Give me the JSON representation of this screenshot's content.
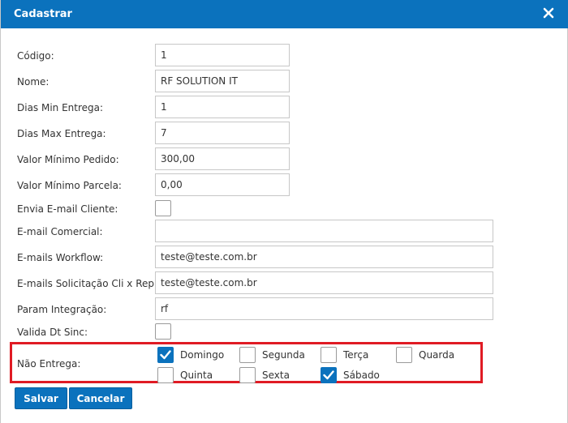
{
  "dialog": {
    "title": "Cadastrar",
    "close_icon": "close-icon"
  },
  "fields": {
    "codigo": {
      "label": "Código:",
      "value": "1"
    },
    "nome": {
      "label": "Nome:",
      "value": "RF SOLUTION IT"
    },
    "dias_min": {
      "label": "Dias Min Entrega:",
      "value": "1"
    },
    "dias_max": {
      "label": "Dias Max Entrega:",
      "value": "7"
    },
    "valor_min_pedido": {
      "label": "Valor Mínimo Pedido:",
      "value": "300,00"
    },
    "valor_min_parcela": {
      "label": "Valor Mínimo Parcela:",
      "value": "0,00"
    },
    "envia_email": {
      "label": "Envia E-mail Cliente:",
      "checked": false
    },
    "email_comercial": {
      "label": "E-mail Comercial:",
      "value": ""
    },
    "emails_workflow": {
      "label": "E-mails Workflow:",
      "value": "teste@teste.com.br"
    },
    "emails_solicitacao": {
      "label": "E-mails Solicitação Cli x Rep:",
      "value": "teste@teste.com.br"
    },
    "param_integracao": {
      "label": "Param Integração:",
      "value": "rf"
    },
    "valida_dt_sinc": {
      "label": "Valida Dt Sinc:",
      "checked": false
    }
  },
  "nao_entrega": {
    "label": "Não Entrega:",
    "highlight_color": "#e01b24",
    "days": [
      {
        "name": "Domingo",
        "checked": true
      },
      {
        "name": "Segunda",
        "checked": false
      },
      {
        "name": "Terça",
        "checked": false
      },
      {
        "name": "Quarda",
        "checked": false
      },
      {
        "name": "Quinta",
        "checked": false
      },
      {
        "name": "Sexta",
        "checked": false
      },
      {
        "name": "Sábado",
        "checked": true
      }
    ]
  },
  "buttons": {
    "save_label": "Salvar",
    "cancel_label": "Cancelar"
  },
  "colors": {
    "accent": "#0b72bd",
    "highlight": "#e01b24"
  }
}
